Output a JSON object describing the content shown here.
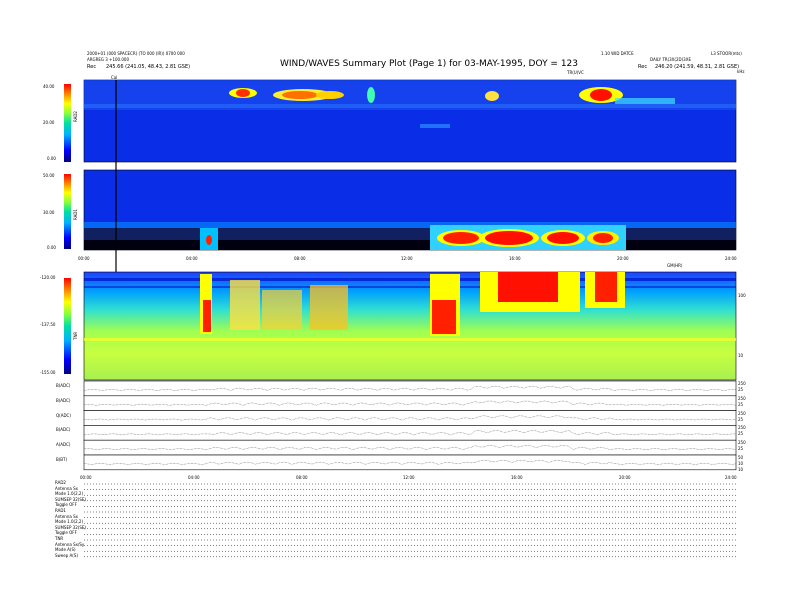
{
  "header": {
    "title": "WIND/WAVES Summary Plot (Page 1) for 03-MAY-1995, DOY = 123",
    "left_line1": "2000+01 (000 SPACECR) (TO 000 (IR)) 0700 000",
    "left_line2": "ARGREG 3 +100.000",
    "left_rec_label": "Rec",
    "left_rec_value": "245.66 (241.05, 48.43, 2.81 GSE)",
    "right_line1": "1.10 WID DATCE",
    "right_line2": "DAILY TR(3X(2D)3XE",
    "right_rec_label": "Rec",
    "right_rec_value": "246.20 (241.59, 48.31, 2.81 GSE)",
    "right_top_corner": "L3 STOOR(mts)",
    "trevinc_label": "TR(U)VC",
    "cal_label": "Cal",
    "unit_label": "kHz"
  },
  "time_axis": {
    "labels": [
      "00:00",
      "04:00",
      "08:00",
      "12:00",
      "16:00",
      "20:00",
      "24:00"
    ],
    "extra_label": "GM(HR)"
  },
  "panels": {
    "rad2": {
      "name": "RAD2",
      "ticks": [
        "40.00",
        "20.00",
        "0.00"
      ]
    },
    "rad1": {
      "name": "RAD1",
      "ticks": [
        "50.00",
        "30.00",
        "0.00"
      ]
    },
    "tnr": {
      "name": "TNR",
      "ticks": [
        "-120.00",
        "-137.50",
        "-155.00"
      ],
      "right_ticks": [
        "100",
        "10"
      ]
    }
  },
  "line_panels": [
    {
      "label": "B(ADC)",
      "right": [
        "250",
        "25"
      ]
    },
    {
      "label": "B(ADC)",
      "right": [
        "250",
        "25"
      ]
    },
    {
      "label": "Q(ADC)",
      "right": [
        "250",
        "25"
      ]
    },
    {
      "label": "B(ADC)",
      "right": [
        "250",
        "25"
      ]
    },
    {
      "label": "A(ADC)",
      "right": [
        "250",
        "25"
      ]
    },
    {
      "label": "B(BT)",
      "right": [
        "50",
        "10",
        "10"
      ]
    }
  ],
  "footer": {
    "lines": [
      "RAD2",
      "Antenna Sx",
      "Mode 1.0(2,2)",
      "SUMSEP 32(SE)",
      "Toggle OFF",
      "RAD1",
      "Antenna Sx",
      "Mode 1.0(2,2)",
      "SUMSEP 32(SE)",
      "Toggle OFF",
      "TNR",
      "Antenna Sx/Sy",
      "Mode A(S)",
      "Sweep A(S)"
    ]
  },
  "colors": {
    "background": "#0030e0",
    "colorbar": [
      "#000080",
      "#0000ff",
      "#00b0ff",
      "#00e0a0",
      "#80ff40",
      "#ffff00",
      "#ff8000",
      "#ff0000"
    ]
  },
  "chart_data": [
    {
      "type": "heatmap",
      "name": "RAD2",
      "x_range_hours": [
        0,
        24
      ],
      "y_tick_labels": [
        "40.00",
        "20.00",
        "0.00"
      ],
      "activity": [
        {
          "start_h": 4.0,
          "end_h": 5.0,
          "level": "high"
        },
        {
          "start_h": 6.0,
          "end_h": 8.0,
          "level": "high"
        },
        {
          "start_h": 9.8,
          "end_h": 10.2,
          "level": "medium"
        },
        {
          "start_h": 14.3,
          "end_h": 14.8,
          "level": "medium"
        },
        {
          "start_h": 18.0,
          "end_h": 19.2,
          "level": "high"
        }
      ]
    },
    {
      "type": "heatmap",
      "name": "RAD1",
      "x_range_hours": [
        0,
        24
      ],
      "y_tick_labels": [
        "50.00",
        "30.00",
        "0.00"
      ],
      "activity": [
        {
          "start_h": 4.3,
          "end_h": 4.6,
          "level": "high"
        },
        {
          "start_h": 12.0,
          "end_h": 14.0,
          "level": "high"
        },
        {
          "start_h": 14.5,
          "end_h": 16.5,
          "level": "high"
        },
        {
          "start_h": 17.0,
          "end_h": 19.0,
          "level": "high"
        },
        {
          "start_h": 19.3,
          "end_h": 20.3,
          "level": "high"
        }
      ]
    },
    {
      "type": "heatmap",
      "name": "TNR",
      "x_range_hours": [
        0,
        24
      ],
      "y_tick_labels": [
        "-120.00",
        "-137.50",
        "-155.00"
      ],
      "activity": [
        {
          "start_h": 4.3,
          "end_h": 5.0,
          "level": "high"
        },
        {
          "start_h": 5.5,
          "end_h": 8.5,
          "level": "medium"
        },
        {
          "start_h": 12.5,
          "end_h": 13.5,
          "level": "high"
        },
        {
          "start_h": 15.0,
          "end_h": 20.0,
          "level": "high"
        }
      ]
    }
  ]
}
